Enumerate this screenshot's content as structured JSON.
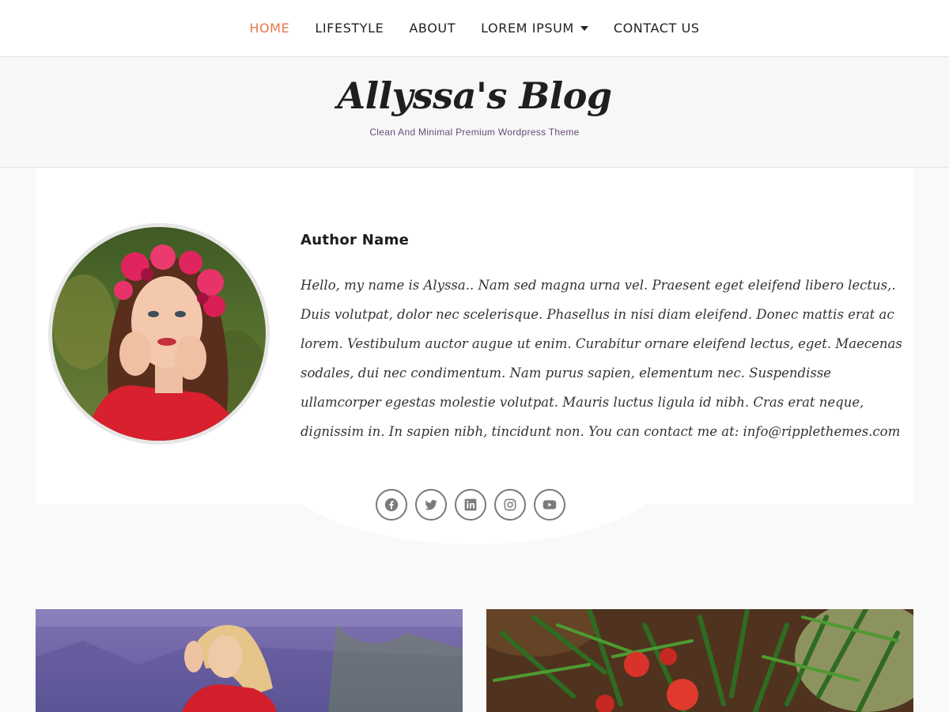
{
  "nav": {
    "items": [
      {
        "label": "HOME",
        "active": true
      },
      {
        "label": "LIFESTYLE"
      },
      {
        "label": "ABOUT"
      },
      {
        "label": "LOREM IPSUM",
        "has_dropdown": true
      },
      {
        "label": "CONTACT US"
      }
    ]
  },
  "header": {
    "title": "Allyssa's Blog",
    "tagline": "Clean And Minimal Premium Wordpress Theme"
  },
  "author": {
    "name": "Author Name",
    "bio": "Hello, my name is Alyssa.. Nam sed magna urna vel. Praesent eget eleifend libero lectus,. Duis volutpat, dolor nec scelerisque. Phasellus in nisi diam eleifend. Donec mattis erat ac lorem. Vestibulum auctor augue ut enim. Curabitur ornare eleifend lectus, eget. Maecenas sodales, dui nec condimentum. Nam purus sapien, elementum nec. Suspendisse ullamcorper egestas molestie volutpat. Mauris luctus ligula id nibh. Cras erat neque, dignissim in. In sapien nibh, tincidunt non. You can contact me at: info@ripplethemes.com",
    "socials": [
      "facebook-icon",
      "twitter-icon",
      "linkedin-icon",
      "instagram-icon",
      "youtube-icon"
    ]
  },
  "colors": {
    "accent": "#e8764a",
    "tagline": "#6a4b78",
    "background": "#f9f9f9"
  }
}
